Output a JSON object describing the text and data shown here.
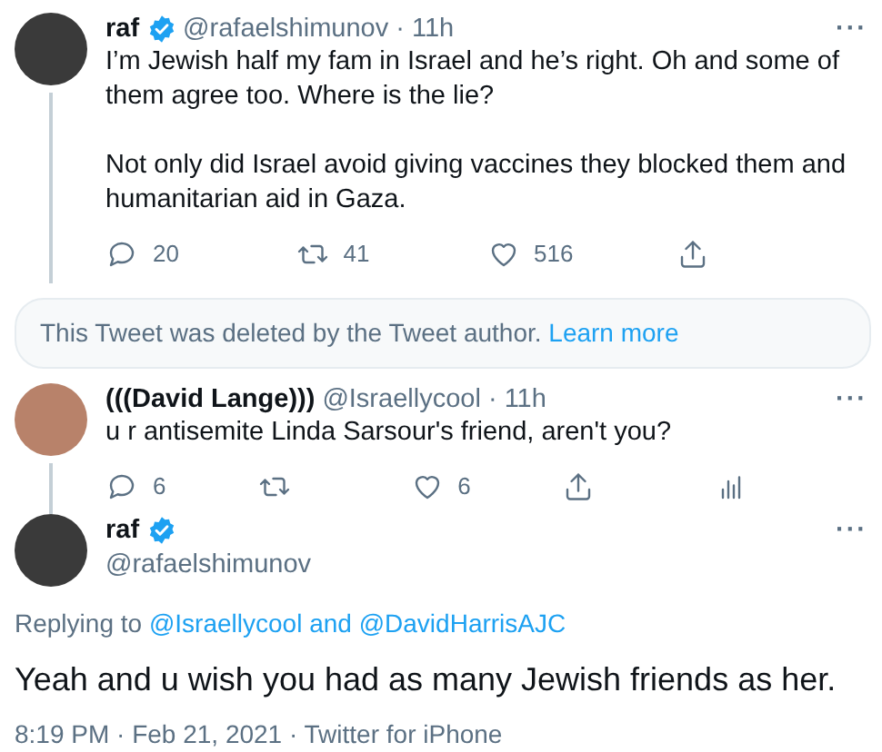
{
  "tweets": [
    {
      "kind": "reply",
      "name": "raf",
      "verified": true,
      "handle": "@rafaelshimunov",
      "separator": "·",
      "time": "11h",
      "more": "···",
      "paragraphs": [
        "I’m Jewish half my fam in Israel and he’s right. Oh and some of them agree too. Where is the lie?",
        "Not only did Israel avoid giving vaccines they blocked them and humanitarian aid in Gaza."
      ],
      "actions": [
        {
          "kind": "reply",
          "count": "20"
        },
        {
          "kind": "retweet",
          "count": "41"
        },
        {
          "kind": "like",
          "count": "516"
        },
        {
          "kind": "share"
        }
      ],
      "thread_below": true
    },
    {
      "kind": "notice",
      "text": "This Tweet was deleted by the Tweet author.",
      "link": "Learn more"
    },
    {
      "kind": "reply",
      "name": "(((David Lange)))",
      "verified": false,
      "handle": "@Israellycool",
      "separator": "·",
      "time": "11h",
      "more": "···",
      "paragraphs": [
        "u r antisemite Linda Sarsour's friend, aren't you?"
      ],
      "actions": [
        {
          "kind": "reply",
          "count": "6"
        },
        {
          "kind": "retweet"
        },
        {
          "kind": "like",
          "count": "6"
        },
        {
          "kind": "share"
        },
        {
          "kind": "analytics"
        }
      ],
      "thread_below": true
    },
    {
      "kind": "main",
      "name": "raf",
      "verified": true,
      "handle": "@rafaelshimunov",
      "more": "···",
      "replying": {
        "prefix": "Replying to",
        "mentions": [
          "@Israellycool",
          "@DavidHarrisAJC"
        ],
        "joiner": "and"
      },
      "text": "Yeah and u wish you had as many Jewish friends as her.",
      "meta_line": "8:19 PM · Feb 21, 2021 · Twitter for iPhone"
    }
  ]
}
